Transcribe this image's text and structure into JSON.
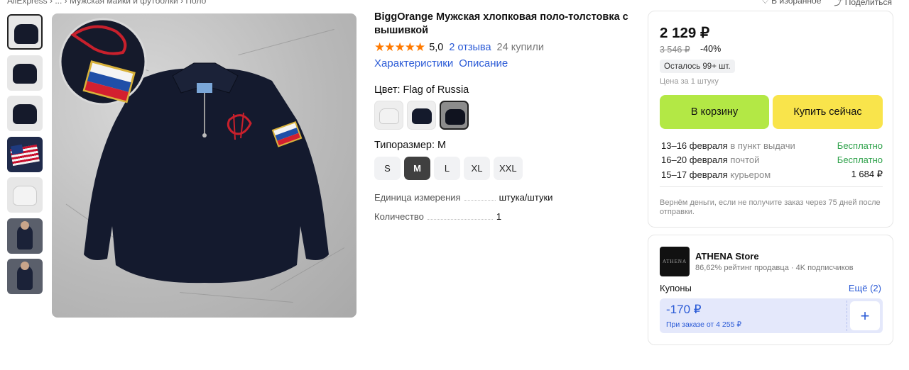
{
  "breadcrumb": "AliExpress  ›  ...  ›  Мужская майки и футболки  ›  Поло",
  "top_actions": {
    "favorite": "♡ В избранное",
    "share": "⤴ Поделиться"
  },
  "product": {
    "title": "BiggOrange Мужская хлопковая поло-толстовка с вышивкой",
    "stars": "★★★★★",
    "rating": "5,0",
    "reviews": "2 отзыва",
    "purchases": "24 купили",
    "tabs": [
      "Характеристики",
      "Описание"
    ],
    "color_label": "Цвет: Flag of Russia",
    "swatches": [
      {
        "name": "white",
        "color": "#f2f2f2"
      },
      {
        "name": "navy",
        "color": "#141a2c"
      },
      {
        "name": "navy-flag",
        "color": "#10131f"
      }
    ],
    "selected_swatch": 2,
    "size_label": "Типоразмер: M",
    "sizes": [
      "S",
      "M",
      "L",
      "XL",
      "XXL"
    ],
    "selected_size": "M",
    "specs": [
      {
        "label": "Единица измерения",
        "value": "штука/штуки"
      },
      {
        "label": "Количество",
        "value": "1"
      }
    ]
  },
  "buy_box": {
    "price": "2 129 ₽",
    "old_price": "3 546 ₽",
    "discount": "-40%",
    "stock": "Осталось 99+ шт.",
    "unit_price": "Цена за 1 штуку",
    "cart_button": "В корзину",
    "buy_button": "Купить сейчас",
    "delivery": [
      {
        "date": "13–16 февраля",
        "method": "в пункт выдачи",
        "price": "Бесплатно",
        "free": true
      },
      {
        "date": "16–20 февраля",
        "method": "почтой",
        "price": "Бесплатно",
        "free": true
      },
      {
        "date": "15–17 февраля",
        "method": "курьером",
        "price": "1 684 ₽",
        "free": false
      }
    ],
    "refund_note": "Вернём деньги, если не получите заказ через 75 дней после отправки."
  },
  "store": {
    "logo_text": "ATHENA",
    "name": "ATHENA Store",
    "meta": "86,62% рейтинг продавца · 4K подписчиков",
    "coupons_label": "Купоны",
    "coupons_more": "Ещё (2)",
    "coupon_amount": "-170 ₽",
    "coupon_condition": "При заказе от 4 255 ₽",
    "coupon_add": "+"
  },
  "colors": {
    "accent_blue": "#2a5ad6",
    "cart_green": "#b3e845",
    "buy_yellow": "#f9e44b",
    "rating_orange": "#ff7a00",
    "free_green": "#2fa24b"
  }
}
